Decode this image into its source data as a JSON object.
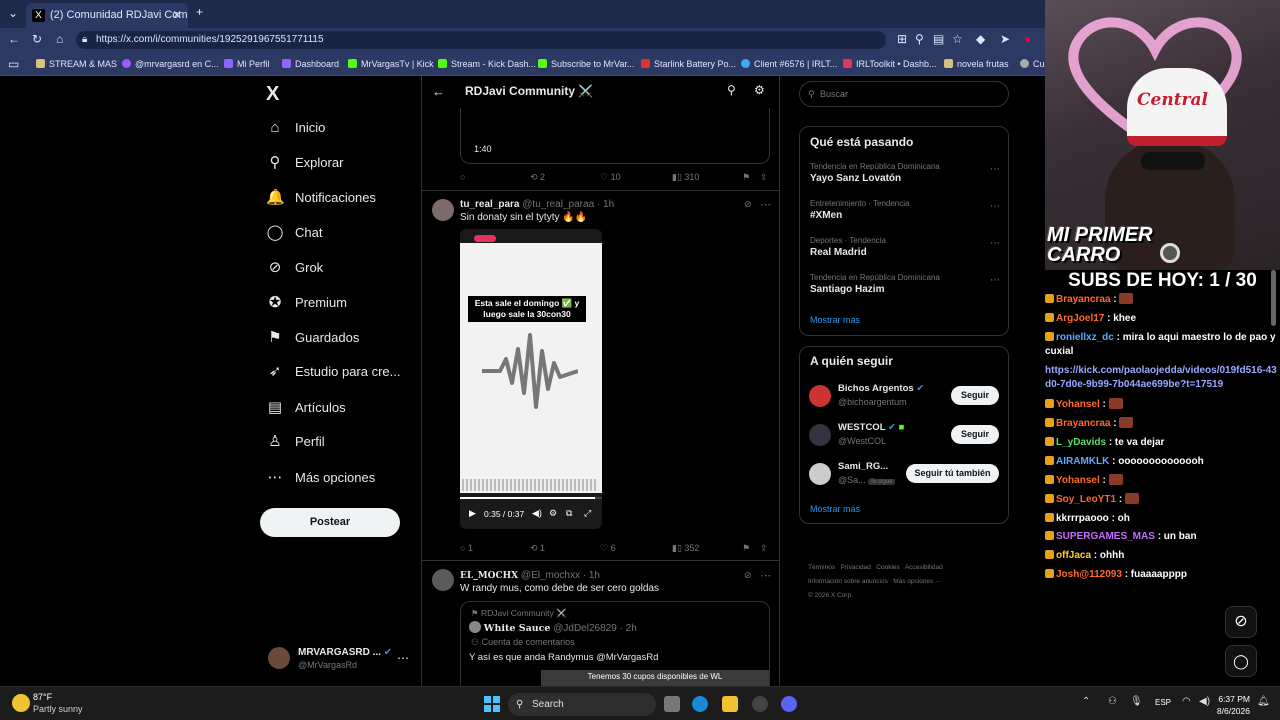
{
  "browser": {
    "tab_title": "(2) Comunidad RDJavi Community",
    "tab_icon": "X",
    "url": "https://x.com/i/communities/1925291967551771115",
    "bookmarks": [
      "STREAM & MAS",
      "@mrvargasrd en C...",
      "Mi Perfil",
      "Dashboard",
      "MrVargasTv | Kick",
      "Stream - Kick Dash...",
      "Subscribe to MrVar...",
      "Starlink Battery Po...",
      "Client #6576 | IRLT...",
      "IRLToolkit • Dashb...",
      "novela frutas",
      "Cu"
    ]
  },
  "sidebar": {
    "logo": "X",
    "items": [
      {
        "label": "Inicio",
        "icon": "home-icon",
        "glyph": "⌂"
      },
      {
        "label": "Explorar",
        "icon": "search-icon",
        "glyph": "⚲"
      },
      {
        "label": "Notificaciones",
        "icon": "bell-icon",
        "glyph": "🔔"
      },
      {
        "label": "Chat",
        "icon": "chat-icon",
        "glyph": "◯"
      },
      {
        "label": "Grok",
        "icon": "grok-icon",
        "glyph": "⊘"
      },
      {
        "label": "Premium",
        "icon": "premium-icon",
        "glyph": "✪"
      },
      {
        "label": "Guardados",
        "icon": "bookmark-icon",
        "glyph": "⚑"
      },
      {
        "label": "Estudio para cre...",
        "icon": "rocket-icon",
        "glyph": "➶"
      },
      {
        "label": "Artículos",
        "icon": "articles-icon",
        "glyph": "▤"
      },
      {
        "label": "Perfil",
        "icon": "profile-icon",
        "glyph": "♙"
      },
      {
        "label": "Más opciones",
        "icon": "more-icon",
        "glyph": "⋯"
      }
    ],
    "post_button": "Postear",
    "account": {
      "name": "MRVARGASRD ...",
      "handle": "@MrVargasRd"
    }
  },
  "community": {
    "title": "RDJavi Community ⚔️",
    "top_post": {
      "duration": "1:40",
      "replies": "",
      "reposts": "2",
      "likes": "10",
      "views": "310"
    },
    "post1": {
      "name": "tu_real_para",
      "handle": "@tu_real_paraa",
      "time": "· 1h",
      "text": "Sin donaty sin el tytyty 🔥🔥",
      "video_caption": "Esta sale el domingo ✅ y luego sale la 30con30",
      "video_time": "0:35 / 0:37",
      "replies": "1",
      "reposts": "1",
      "likes": "6",
      "views": "352"
    },
    "post2": {
      "name": "EL_MOCHX",
      "handle": "@El_mochxx",
      "time": "· 1h",
      "text": "W randy mus, como debe de ser cero goldas",
      "quote_community": "RDJavi Community ⚔️",
      "quote_name": "White Sauce",
      "quote_handle": "@JdDel26829",
      "quote_time": "· 2h",
      "quote_label": "Cuenta de comentarios",
      "quote_text": "Y así es que anda Randymus @MrVargasRd",
      "quote_media_caption": "Tenemos 30 cupos disponibles de WL"
    }
  },
  "right": {
    "search_placeholder": "Buscar",
    "trends_title": "Qué está pasando",
    "trends": [
      {
        "meta": "Tendencia en República Dominicana",
        "name": "Yayo Sanz Lovatón"
      },
      {
        "meta": "Entretenimiento · Tendencia",
        "name": "#XMen"
      },
      {
        "meta": "Deportes · Tendencia",
        "name": "Real Madrid"
      },
      {
        "meta": "Tendencia en República Dominicana",
        "name": "Santiago Hazim"
      }
    ],
    "show_more": "Mostrar más",
    "who_title": "A quién seguir",
    "who": [
      {
        "name": "Bichos Argentos",
        "handle": "@bichoargentum",
        "button": "Seguir"
      },
      {
        "name": "WESTCOL",
        "handle": "@WestCOL",
        "button": "Seguir"
      },
      {
        "name": "Sami_RG...",
        "handle": "@Sa...",
        "tag": "Te sigue",
        "button": "Seguir tú también"
      }
    ],
    "footer": [
      "Términos",
      "Privacidad",
      "Cookies",
      "Accesibilidad",
      "Información sobre anuncios",
      "Más opciones ···",
      "© 2026 X Corp."
    ]
  },
  "stream": {
    "cam_hat": "Central",
    "banner": "MI PRIMER CARRO",
    "subs": "SUBS DE HOY: 1 / 30",
    "chat": [
      {
        "user": "Brayancraa",
        "msg": ":",
        "color": "orange",
        "emote": true
      },
      {
        "user": "ArgJoel17",
        "msg": ": khee",
        "color": "orange"
      },
      {
        "user": "roniellxz_dc",
        "msg": ": mira lo aqui maestro lo de pao y cuxial",
        "color": "blue"
      },
      {
        "user": "",
        "msg": "https://kick.com/paolaojedda/videos/019fd516-43d0-7d0e-9b99-7b044ae699be?t=17519",
        "color": "link"
      },
      {
        "user": "Yohansel",
        "msg": ":",
        "color": "orange",
        "emote": true
      },
      {
        "user": "Brayancraa",
        "msg": ":",
        "color": "orange",
        "emote": true
      },
      {
        "user": "L_yDavids",
        "msg": ": te va dejar",
        "color": "green"
      },
      {
        "user": "AIRAMKLK",
        "msg": ": oooooooooooooh",
        "color": "blue"
      },
      {
        "user": "Yohansel",
        "msg": ":",
        "color": "orange",
        "emote": true
      },
      {
        "user": "Soy_LeoYT1",
        "msg": ":",
        "color": "orange",
        "emote": true
      },
      {
        "user": "kkrrrpaooo",
        "msg": ": oh",
        "color": "white"
      },
      {
        "user": "SUPERGAMES_MAS",
        "msg": ": un ban",
        "color": "purple"
      },
      {
        "user": "offJaca",
        "msg": ": ohhh",
        "color": "yellow"
      },
      {
        "user": "Josh@112093",
        "msg": ": fuaaaapppp",
        "color": "orange"
      }
    ]
  },
  "taskbar": {
    "weather_temp": "87°F",
    "weather_text": "Partly sunny",
    "search": "Search",
    "lang": "ESP",
    "time": "6:37 PM",
    "date": "8/6/2026"
  }
}
